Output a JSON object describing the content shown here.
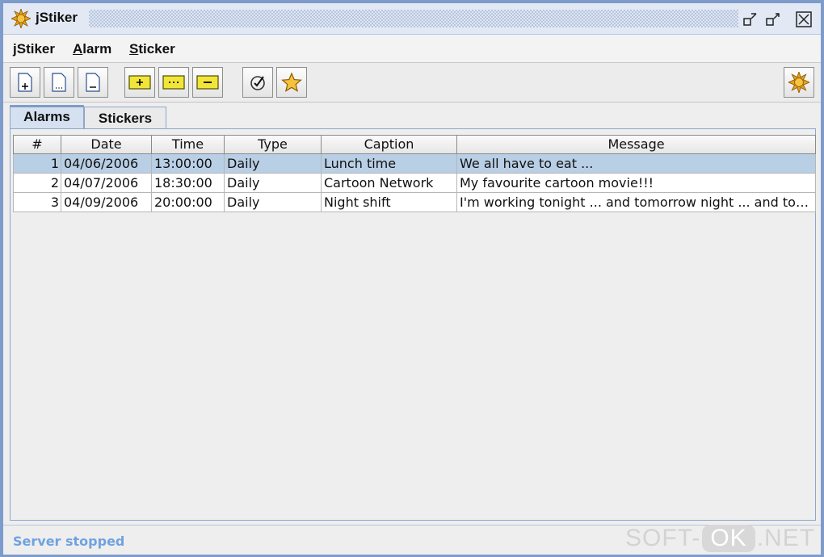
{
  "window": {
    "title": "jStiker",
    "accent_color": "#7e9ccb"
  },
  "menu": {
    "items": [
      {
        "mnemonic": "j",
        "rest": "Stiker"
      },
      {
        "mnemonic": "A",
        "rest": "larm"
      },
      {
        "mnemonic": "S",
        "rest": "ticker"
      }
    ]
  },
  "toolbar": {
    "buttons": [
      "new-alarm-icon",
      "edit-alarm-icon",
      "delete-alarm-icon",
      "new-sticker-icon",
      "edit-sticker-icon",
      "delete-sticker-icon",
      "check-icon",
      "star-icon",
      "settings-gear-icon"
    ]
  },
  "tabs": [
    {
      "label": "Alarms",
      "active": true
    },
    {
      "label": "Stickers",
      "active": false
    }
  ],
  "table": {
    "columns": [
      "#",
      "Date",
      "Time",
      "Type",
      "Caption",
      "Message"
    ],
    "rows": [
      {
        "num": "1",
        "date": "04/06/2006",
        "time": "13:00:00",
        "type": "Daily",
        "caption": "Lunch time",
        "message": "We all have to eat ...",
        "selected": true
      },
      {
        "num": "2",
        "date": "04/07/2006",
        "time": "18:30:00",
        "type": "Daily",
        "caption": "Cartoon Network",
        "message": "My favourite cartoon movie!!!",
        "selected": false
      },
      {
        "num": "3",
        "date": "04/09/2006",
        "time": "20:00:00",
        "type": "Daily",
        "caption": "Night shift",
        "message": "I'm working tonight ... and tomorrow night ... and tom...",
        "selected": false
      }
    ]
  },
  "status": {
    "text": "Server stopped",
    "color": "#6fa2e0"
  },
  "watermark": {
    "prefix": "SOFT-",
    "highlight": "OK",
    "suffix": ".NET"
  }
}
